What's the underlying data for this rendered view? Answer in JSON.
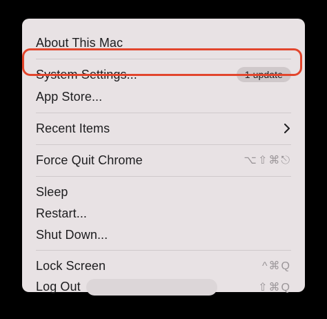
{
  "menu": {
    "about": "About This Mac",
    "system_settings": "System Settings...",
    "update_badge": "1 update",
    "app_store": "App Store...",
    "recent_items": "Recent Items",
    "force_quit": "Force Quit Chrome",
    "force_quit_shortcut": "⌥⇧⌘⎋",
    "sleep": "Sleep",
    "restart": "Restart...",
    "shut_down": "Shut Down...",
    "lock_screen": "Lock Screen",
    "lock_screen_shortcut": "^⌘Q",
    "log_out": "Log Out",
    "log_out_shortcut": "⇧⌘Q"
  },
  "icons": {
    "submenu": "chevron-right-icon"
  },
  "colors": {
    "menu_background": "#e8e2e4",
    "highlight_ring": "#e2452c",
    "badge_background": "#cfc8ca"
  }
}
